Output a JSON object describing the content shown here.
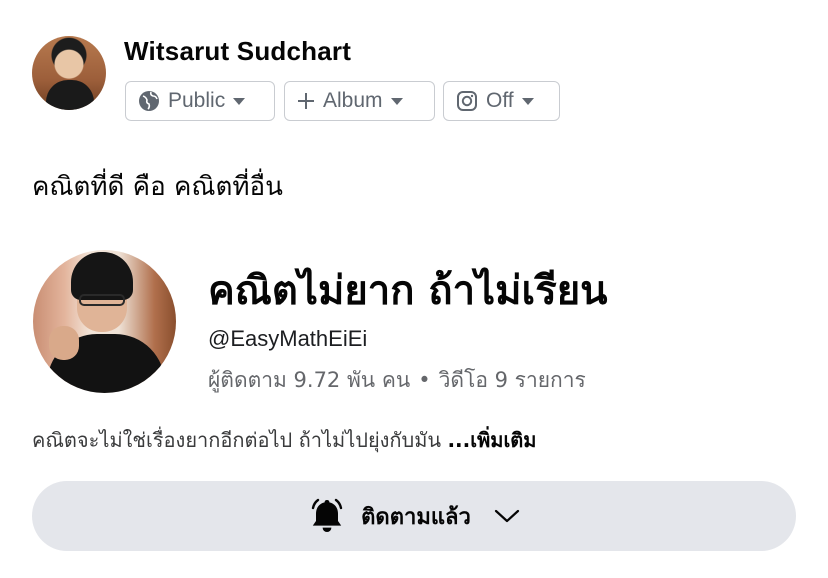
{
  "composer": {
    "user_name": "Witsarut Sudchart",
    "privacy_label": "Public",
    "album_label": "Album",
    "instagram_label": "Off",
    "post_text": "คณิตที่ดี คือ คณิตที่อื่น"
  },
  "page_card": {
    "title": "คณิตไม่ยาก ถ้าไม่เรียน",
    "handle": "@EasyMathEiEi",
    "followers": "ผู้ติดตาม 9.72 พัน คน",
    "separator": "•",
    "videos": "วิดีโอ 9 รายการ",
    "description": "คณิตจะไม่ใช่เรื่องยากอีกต่อไป ถ้าไม่ไปยุ่งกับมัน",
    "see_more": "...เพิ่มเติม",
    "follow_button_label": "ติดตามแล้ว"
  },
  "icons": {
    "privacy": "globe-icon",
    "album": "plus-icon",
    "instagram": "instagram-icon",
    "follow": "bell-icon",
    "follow_menu": "chevron-down-icon"
  }
}
